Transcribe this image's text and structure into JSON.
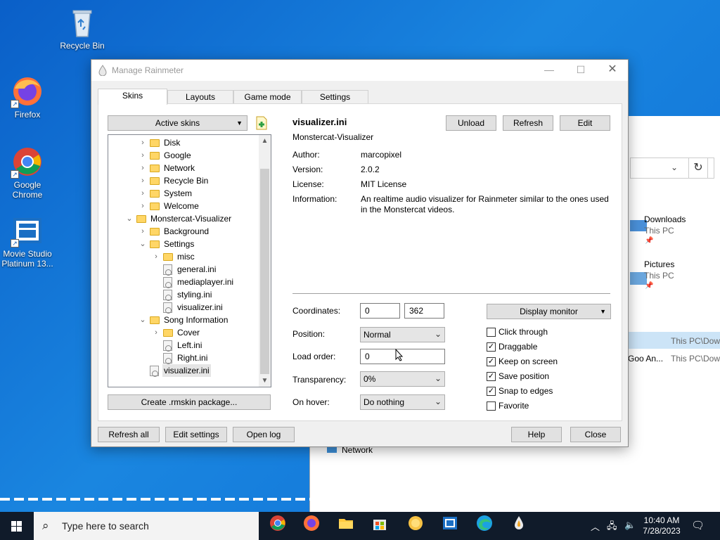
{
  "desktop": {
    "icons": [
      {
        "label": "Recycle Bin"
      },
      {
        "label": "Firefox"
      },
      {
        "label": "Google Chrome"
      },
      {
        "label": "Movie Studio Platinum 13..."
      }
    ]
  },
  "explorer": {
    "quick_access": [
      {
        "title": "Downloads",
        "sub": "This PC"
      },
      {
        "title": "Pictures",
        "sub": "This PC"
      }
    ],
    "recent_paths": [
      "This PC\\Dow",
      "This PC\\Dow"
    ],
    "recent_name": "Goo An...",
    "network_label": "Network"
  },
  "dialog": {
    "title": "Manage Rainmeter",
    "tabs": [
      "Skins",
      "Layouts",
      "Game mode",
      "Settings"
    ],
    "active_skins_label": "Active skins",
    "create_package_label": "Create .rmskin package...",
    "tree": [
      {
        "label": "Disk",
        "kind": "folder",
        "expander": "›"
      },
      {
        "label": "Google",
        "kind": "folder",
        "expander": "›"
      },
      {
        "label": "Network",
        "kind": "folder",
        "expander": "›"
      },
      {
        "label": "Recycle Bin",
        "kind": "folder",
        "expander": "›"
      },
      {
        "label": "System",
        "kind": "folder",
        "expander": "›"
      },
      {
        "label": "Welcome",
        "kind": "folder",
        "expander": "›"
      },
      {
        "label": "Monstercat-Visualizer",
        "kind": "folder",
        "expander": "⌄"
      },
      {
        "label": "Background",
        "kind": "folder",
        "expander": "›"
      },
      {
        "label": "Settings",
        "kind": "folder",
        "expander": "⌄"
      },
      {
        "label": "misc",
        "kind": "folder",
        "expander": "›"
      },
      {
        "label": "general.ini",
        "kind": "file"
      },
      {
        "label": "mediaplayer.ini",
        "kind": "file"
      },
      {
        "label": "styling.ini",
        "kind": "file"
      },
      {
        "label": "visualizer.ini",
        "kind": "file"
      },
      {
        "label": "Song Information",
        "kind": "folder",
        "expander": "⌄"
      },
      {
        "label": "Cover",
        "kind": "folder",
        "expander": "›"
      },
      {
        "label": "Left.ini",
        "kind": "file"
      },
      {
        "label": "Right.ini",
        "kind": "file"
      },
      {
        "label": "visualizer.ini",
        "kind": "file",
        "selected": true
      }
    ],
    "skin": {
      "name": "visualizer.ini",
      "config": "Monstercat-Visualizer",
      "author_label": "Author:",
      "author": "marcopixel",
      "version_label": "Version:",
      "version": "2.0.2",
      "license_label": "License:",
      "license": "MIT License",
      "info_label": "Information:",
      "info": "An realtime audio visualizer for Rainmeter similar to the ones used in the Monstercat videos."
    },
    "actions": {
      "unload": "Unload",
      "refresh": "Refresh",
      "edit": "Edit"
    },
    "settings": {
      "coordinates_label": "Coordinates:",
      "x": "0",
      "y": "362",
      "position_label": "Position:",
      "position": "Normal",
      "load_order_label": "Load order:",
      "load_order": "0",
      "transparency_label": "Transparency:",
      "transparency": "0%",
      "on_hover_label": "On hover:",
      "on_hover": "Do nothing",
      "display_monitor": "Display monitor"
    },
    "checkboxes": [
      {
        "label": "Click through",
        "checked": false
      },
      {
        "label": "Draggable",
        "checked": true
      },
      {
        "label": "Keep on screen",
        "checked": true
      },
      {
        "label": "Save position",
        "checked": true
      },
      {
        "label": "Snap to edges",
        "checked": true
      },
      {
        "label": "Favorite",
        "checked": false
      }
    ],
    "footer": {
      "refresh_all": "Refresh all",
      "edit_settings": "Edit settings",
      "open_log": "Open log",
      "help": "Help",
      "close": "Close"
    }
  },
  "taskbar": {
    "search_placeholder": "Type here to search",
    "time": "10:40 AM",
    "date": "7/28/2023",
    "colors": {
      "bar": "#101b2a",
      "accent": "#0a5fc8"
    }
  }
}
